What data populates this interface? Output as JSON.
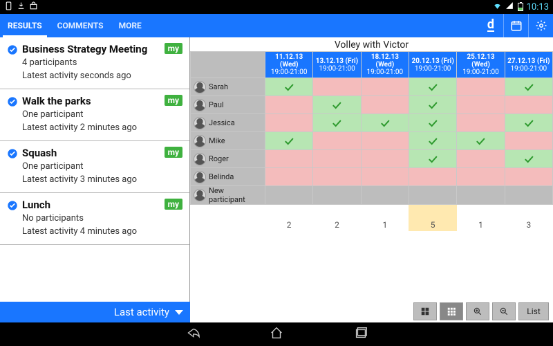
{
  "status": {
    "clock": "10:13"
  },
  "topbar": {
    "tabs": [
      "RESULTS",
      "COMMENTS",
      "MORE"
    ],
    "active_tab": 0
  },
  "polls": [
    {
      "title": "Business Strategy Meeting",
      "badge": "my",
      "participants": "4 participants",
      "activity": "Latest activity seconds ago"
    },
    {
      "title": "Walk the parks",
      "badge": "my",
      "participants": "One participant",
      "activity": "Latest activity 2 minutes ago"
    },
    {
      "title": "Squash",
      "badge": "my",
      "participants": "One participant",
      "activity": "Latest activity 3 minutes ago"
    },
    {
      "title": "Lunch",
      "badge": "my",
      "participants": "No participants",
      "activity": "Latest activity 4 minutes ago"
    }
  ],
  "left_bottom_label": "Last activity",
  "grid": {
    "title": "Volley with Victor",
    "columns": [
      {
        "date": "11.12.13 (Wed)",
        "time": "19:00-21:00"
      },
      {
        "date": "13.12.13 (Fri)",
        "time": "19:00-21:00"
      },
      {
        "date": "18.12.13 (Wed)",
        "time": "19:00-21:00"
      },
      {
        "date": "20.12.13 (Fri)",
        "time": "19:00-21:00"
      },
      {
        "date": "25.12.13 (Wed)",
        "time": "19:00-21:00"
      },
      {
        "date": "27.12.13 (Fri)",
        "time": "19:00-21:00"
      }
    ],
    "rows": [
      {
        "name": "Sarah",
        "cells": [
          "yes",
          "no",
          "no",
          "yes",
          "no",
          "yes"
        ]
      },
      {
        "name": "Paul",
        "cells": [
          "no",
          "yes",
          "no",
          "yes",
          "no",
          "no"
        ]
      },
      {
        "name": "Jessica",
        "cells": [
          "no",
          "yes",
          "yes",
          "yes",
          "no",
          "yes"
        ]
      },
      {
        "name": "Mike",
        "cells": [
          "yes",
          "no",
          "no",
          "yes",
          "yes",
          "no"
        ]
      },
      {
        "name": "Roger",
        "cells": [
          "no",
          "no",
          "no",
          "yes",
          "no",
          "yes"
        ]
      },
      {
        "name": "Belinda",
        "cells": [
          "no",
          "no",
          "no",
          "no",
          "no",
          "no"
        ]
      },
      {
        "name": "New participant",
        "cells": [
          "na",
          "na",
          "na",
          "na",
          "na",
          "na"
        ]
      }
    ],
    "counts": [
      "2",
      "2",
      "1",
      "5",
      "1",
      "3"
    ],
    "highlight_col": 3
  },
  "toolbar": {
    "list_label": "List"
  }
}
